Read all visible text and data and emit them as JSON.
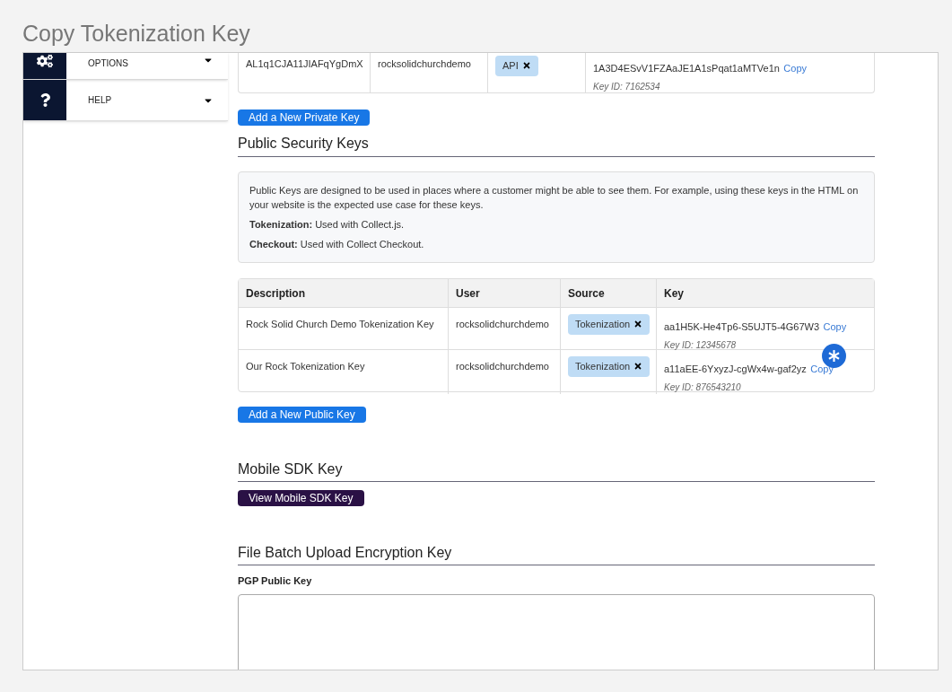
{
  "page_title": "Copy Tokenization Key",
  "sidebar": {
    "items": [
      {
        "label": "OPTIONS",
        "kind": "gears",
        "expanded": false
      },
      {
        "label": "HELP",
        "kind": "question",
        "expanded": false
      }
    ]
  },
  "private_keys": {
    "rows": [
      {
        "description": "AL1q1CJA11JIAFqYgDmX",
        "user": "rocksolidchurchdemo",
        "source": "API",
        "key": "1A3D4ESvV1FZAaJE1A1sPqat1aMTVe1n",
        "copy": "Copy",
        "key_id": "Key ID: 7162534"
      }
    ],
    "add_button": "Add a New Private Key"
  },
  "public_keys": {
    "heading": "Public Security Keys",
    "info": [
      "Public Keys are designed to be used in places where a customer might be able to see them. For example, using these keys in the HTML on your website is the expected use case for these keys.",
      "**Tokenization:** Used with Collect.js.",
      "**Checkout:** Used with Collect Checkout."
    ],
    "columns": [
      "Description",
      "User",
      "Source",
      "Key"
    ],
    "rows": [
      {
        "description": "Rock Solid Church Demo Tokenization Key",
        "user": "rocksolidchurchdemo",
        "source": "Tokenization",
        "key": "aa1H5K-He4Tp6-S5UJT5-4G67W3",
        "copy": "Copy",
        "key_id": "Key ID: 12345678"
      },
      {
        "description": "Our Rock Tokenization Key",
        "user": "rocksolidchurchdemo",
        "source": "Tokenization",
        "key": "a11aEE-6YxyzJ-cgWx4w-gaf2yz",
        "copy": "Copy",
        "key_id": "Key ID: 876543210"
      }
    ],
    "add_button": "Add a New Public Key"
  },
  "mobile_sdk": {
    "heading": "Mobile SDK Key",
    "button": "View Mobile SDK Key"
  },
  "file_batch": {
    "heading": "File Batch Upload Encryption Key",
    "field_label": "PGP Public Key"
  }
}
